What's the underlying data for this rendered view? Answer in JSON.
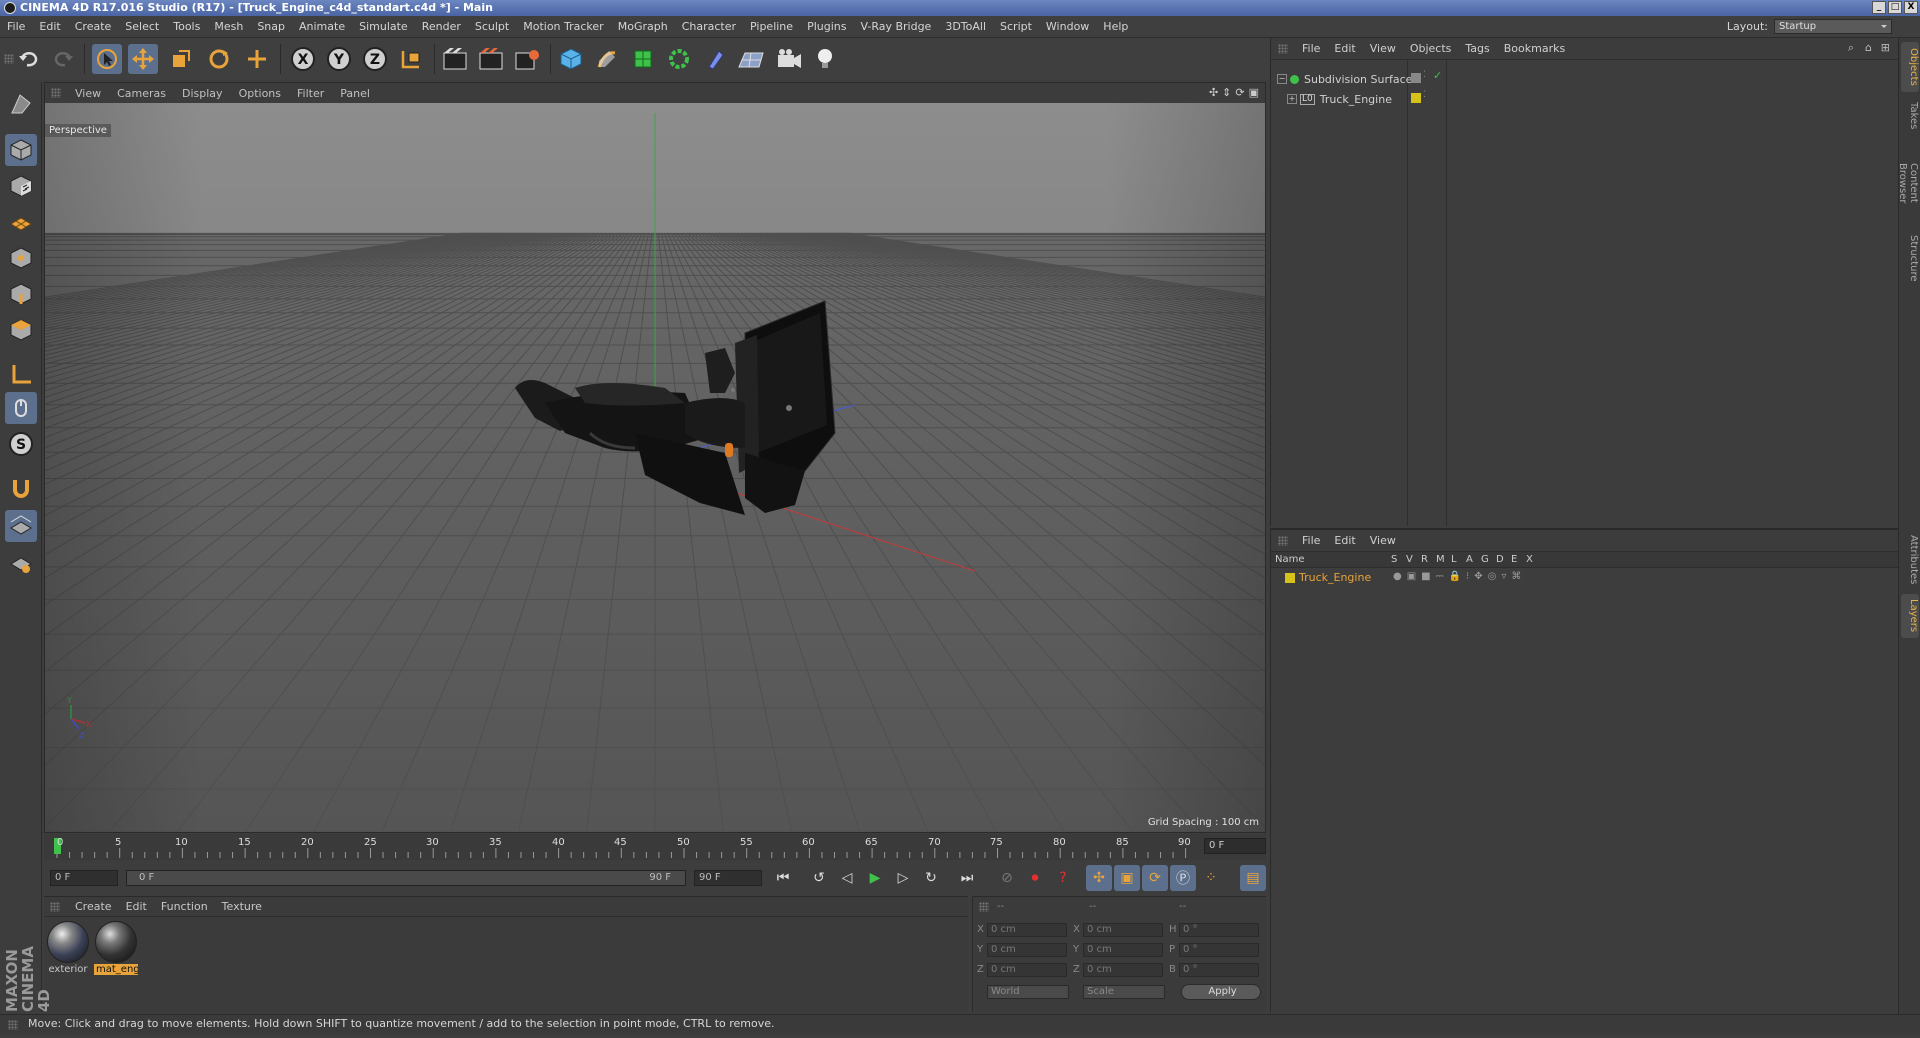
{
  "window": {
    "title": "CINEMA 4D R17.016 Studio (R17) - [Truck_Engine_c4d_standart.c4d *] - Main",
    "controls": [
      "_",
      "□",
      "X"
    ]
  },
  "menubar": {
    "items": [
      "File",
      "Edit",
      "Create",
      "Select",
      "Tools",
      "Mesh",
      "Snap",
      "Animate",
      "Simulate",
      "Render",
      "Sculpt",
      "Motion Tracker",
      "MoGraph",
      "Character",
      "Pipeline",
      "Plugins",
      "V-Ray Bridge",
      "3DToAll",
      "Script",
      "Window",
      "Help"
    ],
    "layout_label": "Layout:",
    "layout_value": "Startup"
  },
  "toolbar": {
    "axis_x": "X",
    "axis_y": "Y",
    "axis_z": "Z",
    "icons": [
      "undo-icon",
      "redo-icon",
      "select-icon",
      "move-icon",
      "scale-icon",
      "rotate-icon",
      "last-tool-icon",
      "x-axis-icon",
      "y-axis-icon",
      "z-axis-icon",
      "coordinate-system-icon",
      "render-view-icon",
      "render-picture-viewer-icon",
      "render-settings-icon",
      "cube-icon",
      "pen-icon",
      "subdivision-icon",
      "array-icon",
      "deformer-icon",
      "floor-icon",
      "camera-icon",
      "light-icon"
    ]
  },
  "viewport": {
    "menu": [
      "View",
      "Cameras",
      "Display",
      "Options",
      "Filter",
      "Panel"
    ],
    "label": "Perspective",
    "grid_spacing": "Grid Spacing : 100 cm",
    "axis_labels": {
      "x": "X",
      "y": "Y",
      "z": "Z"
    }
  },
  "timeline": {
    "ticks": [
      "0",
      "5",
      "10",
      "15",
      "20",
      "25",
      "30",
      "35",
      "40",
      "45",
      "50",
      "55",
      "60",
      "65",
      "70",
      "75",
      "80",
      "85",
      "90"
    ],
    "current_frame": "0 F"
  },
  "transport": {
    "start_field": "0 F",
    "range_start": "0 F",
    "range_end": "90 F",
    "end_field": "90 F"
  },
  "materials": {
    "menu": [
      "Create",
      "Edit",
      "Function",
      "Texture"
    ],
    "items": [
      {
        "name": "exterior",
        "selected": false
      },
      {
        "name": "mat_eng",
        "selected": true
      }
    ]
  },
  "coordinates": {
    "col_headers": [
      "--",
      "--",
      "--"
    ],
    "rows": [
      {
        "l1": "X",
        "v1": "0 cm",
        "l2": "X",
        "v2": "0 cm",
        "l3": "H",
        "v3": "0 °"
      },
      {
        "l1": "Y",
        "v1": "0 cm",
        "l2": "Y",
        "v2": "0 cm",
        "l3": "P",
        "v3": "0 °"
      },
      {
        "l1": "Z",
        "v1": "0 cm",
        "l2": "Z",
        "v2": "0 cm",
        "l3": "B",
        "v3": "0 °"
      }
    ],
    "mode1": "World",
    "mode2": "Scale",
    "apply": "Apply"
  },
  "object_manager": {
    "menu": [
      "File",
      "Edit",
      "View",
      "Objects",
      "Tags",
      "Bookmarks"
    ],
    "objects": [
      {
        "name": "Subdivision Surface",
        "level": 0
      },
      {
        "name": "Truck_Engine",
        "level": 1
      }
    ]
  },
  "layer_manager": {
    "menu": [
      "File",
      "Edit",
      "View"
    ],
    "header_name": "Name",
    "columns": [
      "S",
      "V",
      "R",
      "M",
      "L",
      "A",
      "G",
      "D",
      "E",
      "X"
    ],
    "layers": [
      {
        "name": "Truck_Engine",
        "color": "#d6c21a"
      }
    ]
  },
  "right_tabs": [
    "Objects",
    "Takes",
    "Content Browser",
    "Structure",
    "Attributes",
    "Layers"
  ],
  "status": {
    "text": "Move: Click and drag to move elements. Hold down SHIFT to quantize movement / add to the selection in point mode, CTRL to remove."
  },
  "branding": {
    "logo": "MAXON CINEMA 4D"
  },
  "colors": {
    "accent": "#e8a33a",
    "selection": "#5c708e",
    "layer_yellow": "#d6c21a",
    "timeline_green": "#3fc24a"
  }
}
